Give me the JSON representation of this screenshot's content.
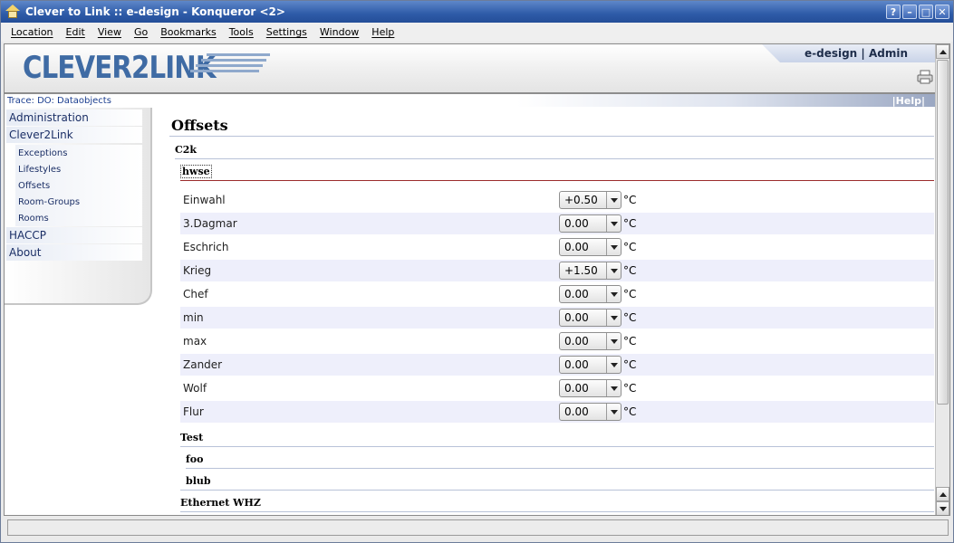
{
  "window": {
    "title": "Clever to Link :: e-design - Konqueror <2>",
    "buttons": {
      "help": "?",
      "minimize": "–",
      "maximize": "□",
      "close": "✕"
    }
  },
  "menubar": [
    "Location",
    "Edit",
    "View",
    "Go",
    "Bookmarks",
    "Tools",
    "Settings",
    "Window",
    "Help"
  ],
  "header": {
    "logo_text": "CLEVER2LINK",
    "user_label": "e-design | Admin",
    "print_icon": "printer-icon"
  },
  "trace": {
    "text": "Trace: DO: Dataobjects",
    "help": "|Help|"
  },
  "sidebar": {
    "items": [
      {
        "label": "Administration",
        "level": 1
      },
      {
        "label": "Clever2Link",
        "level": 1
      },
      {
        "label": "Exceptions",
        "level": 2
      },
      {
        "label": "Lifestyles",
        "level": 2
      },
      {
        "label": "Offsets",
        "level": 2
      },
      {
        "label": "Room-Groups",
        "level": 2
      },
      {
        "label": "Rooms",
        "level": 2
      },
      {
        "label": "HACCP",
        "level": 1
      },
      {
        "label": "About",
        "level": 1
      }
    ]
  },
  "main": {
    "title": "Offsets",
    "group_c2k": "C2k",
    "subgroup": "hwse",
    "unit": "°C",
    "rows": [
      {
        "label": "Einwahl",
        "value": "+0.50"
      },
      {
        "label": "3.Dagmar",
        "value": "0.00"
      },
      {
        "label": "Eschrich",
        "value": "0.00"
      },
      {
        "label": "Krieg",
        "value": "+1.50"
      },
      {
        "label": "Chef",
        "value": "0.00"
      },
      {
        "label": "min",
        "value": "0.00"
      },
      {
        "label": "max",
        "value": "0.00"
      },
      {
        "label": "Zander",
        "value": "0.00"
      },
      {
        "label": "Wolf",
        "value": "0.00"
      },
      {
        "label": "Flur",
        "value": "0.00"
      }
    ],
    "group_test": "Test",
    "sub_foo": "foo",
    "sub_blub": "blub",
    "group_ethernet": "Ethernet WHZ"
  },
  "status": {
    "text": ""
  },
  "colors": {
    "titlebar": "#2e5ba8",
    "accent": "#3f6ba4",
    "row_alt": "#eeeffb",
    "divider_red": "#9c2c2c"
  }
}
